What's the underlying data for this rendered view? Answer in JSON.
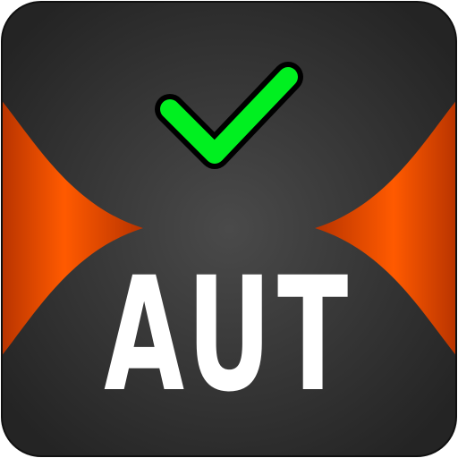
{
  "icon": {
    "label": "AUT",
    "symbol": "check-icon",
    "colors": {
      "background": "#242424",
      "background_glow": "#4a4a4a",
      "accent": "#ff5a00",
      "accent_dark": "#b73300",
      "check": "#00f020",
      "check_outline": "#000000",
      "text": "#ffffff"
    }
  }
}
